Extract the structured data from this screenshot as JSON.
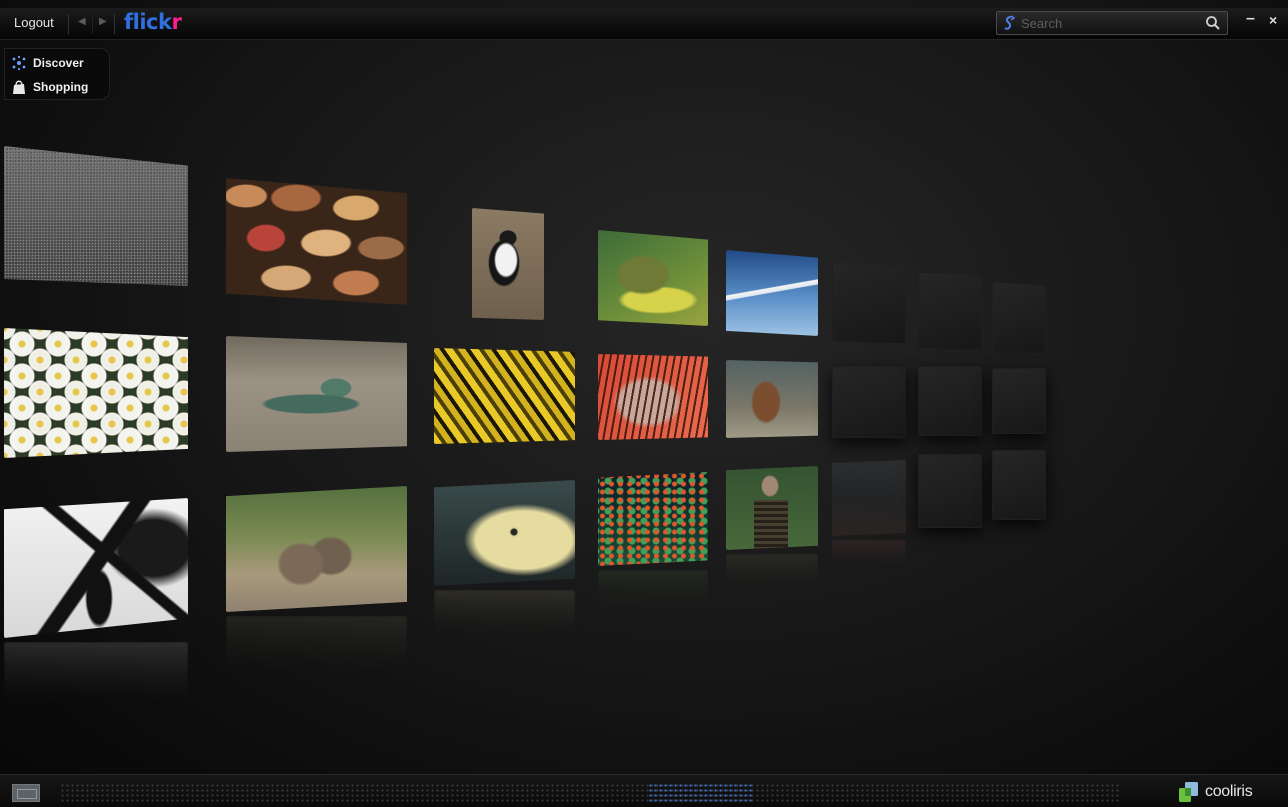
{
  "topbar": {
    "logout_label": "Logout",
    "brand_part1": "flick",
    "brand_part2": "r",
    "search_placeholder": "Search",
    "minimize_label": "–",
    "close_label": "×"
  },
  "menu": {
    "items": [
      {
        "label": "Discover",
        "icon": "discover-icon"
      },
      {
        "label": "Shopping",
        "icon": "shopping-bag-icon"
      }
    ]
  },
  "colors": {
    "brand_blue": "#2f6fe0",
    "brand_pink": "#ff1e8a",
    "scrubber_active": "#3f71c9",
    "background": "#141414"
  },
  "footer": {
    "logo_label": "cooliris"
  },
  "wall": {
    "photos": [
      "gravel-photo",
      "stone-wall-photo",
      "penguin-photo",
      "sea-turtle-photo",
      "airplane-photo",
      "white-flowers-photo",
      "lizard-photo",
      "yellow-bamboo-photo",
      "lionfish-photo",
      "monkey-photo",
      "tree-silhouette-photo",
      "baboons-photo",
      "fish-photo",
      "coral-reef-photo",
      "man-portrait-photo",
      "landscape-photo"
    ],
    "empty_tiles": 8
  }
}
